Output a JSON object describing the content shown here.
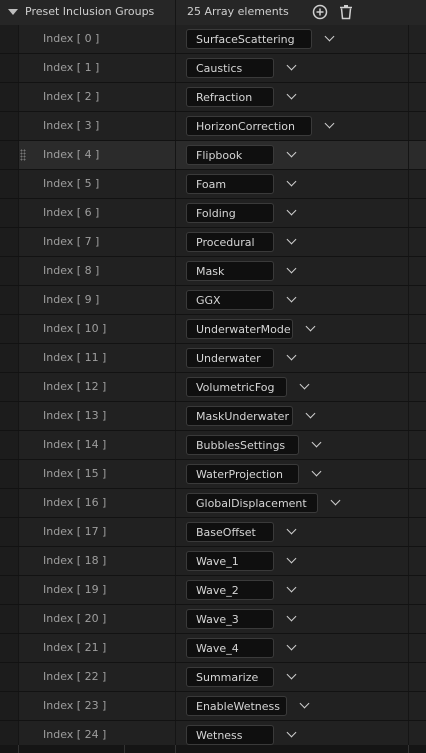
{
  "header": {
    "title": "Preset Inclusion Groups",
    "count": "25 Array elements",
    "add_icon": "add-circle-icon",
    "delete_icon": "trash-icon"
  },
  "rows": [
    {
      "index": "Index [ 0 ]",
      "value": "SurfaceScattering"
    },
    {
      "index": "Index [ 1 ]",
      "value": "Caustics"
    },
    {
      "index": "Index [ 2 ]",
      "value": "Refraction"
    },
    {
      "index": "Index [ 3 ]",
      "value": "HorizonCorrection"
    },
    {
      "index": "Index [ 4 ]",
      "value": "Flipbook"
    },
    {
      "index": "Index [ 5 ]",
      "value": "Foam"
    },
    {
      "index": "Index [ 6 ]",
      "value": "Folding"
    },
    {
      "index": "Index [ 7 ]",
      "value": "Procedural"
    },
    {
      "index": "Index [ 8 ]",
      "value": "Mask"
    },
    {
      "index": "Index [ 9 ]",
      "value": "GGX"
    },
    {
      "index": "Index [ 10 ]",
      "value": "UnderwaterMode"
    },
    {
      "index": "Index [ 11 ]",
      "value": "Underwater"
    },
    {
      "index": "Index [ 12 ]",
      "value": "VolumetricFog"
    },
    {
      "index": "Index [ 13 ]",
      "value": "MaskUnderwater"
    },
    {
      "index": "Index [ 14 ]",
      "value": "BubblesSettings"
    },
    {
      "index": "Index [ 15 ]",
      "value": "WaterProjection"
    },
    {
      "index": "Index [ 16 ]",
      "value": "GlobalDisplacement"
    },
    {
      "index": "Index [ 17 ]",
      "value": "BaseOffset"
    },
    {
      "index": "Index [ 18 ]",
      "value": "Wave_1"
    },
    {
      "index": "Index [ 19 ]",
      "value": "Wave_2"
    },
    {
      "index": "Index [ 20 ]",
      "value": "Wave_3"
    },
    {
      "index": "Index [ 21 ]",
      "value": "Wave_4"
    },
    {
      "index": "Index [ 22 ]",
      "value": "Summarize"
    },
    {
      "index": "Index [ 23 ]",
      "value": "EnableWetness"
    },
    {
      "index": "Index [ 24 ]",
      "value": "Wetness"
    }
  ],
  "highlighted_row": 4,
  "colors": {
    "panel_bg": "#212121",
    "header_bg": "#262626",
    "combo_bg": "#0f0f0f"
  }
}
